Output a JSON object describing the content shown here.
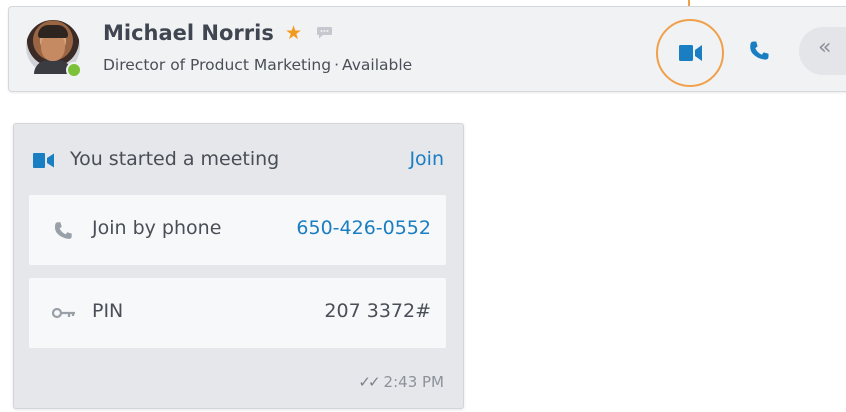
{
  "contact": {
    "name": "Michael Norris",
    "title": "Director of Product Marketing",
    "separator": "·",
    "status": "Available",
    "favorite_icon": "star-icon",
    "chat_icon": "chat-icon"
  },
  "toolbar": {
    "video_icon": "video-camera-icon",
    "phone_icon": "phone-icon",
    "collapse_label": "«"
  },
  "meeting": {
    "title": "You started a meeting",
    "join_label": "Join",
    "phone_label": "Join by phone",
    "phone_number": "650-426-0552",
    "pin_label": "PIN",
    "pin_value": "207 3372#",
    "read_marker": "✓✓",
    "timestamp": "2:43 PM"
  },
  "colors": {
    "accent_blue": "#1a7ec2",
    "callout_orange": "#f0a04b",
    "presence_green": "#7cc13a",
    "star_orange": "#f39a1e"
  }
}
